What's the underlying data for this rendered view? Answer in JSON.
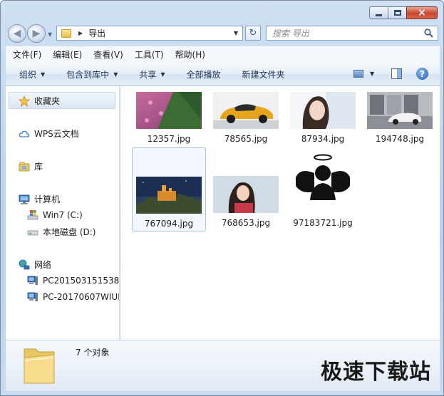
{
  "window": {
    "caption": {
      "minimize": "minimize",
      "maximize": "maximize",
      "close": "×"
    }
  },
  "navigation": {
    "address": {
      "path": "导出"
    },
    "search": {
      "placeholder": "搜索 导出"
    }
  },
  "menubar": {
    "items": [
      "文件(F)",
      "编辑(E)",
      "查看(V)",
      "工具(T)",
      "帮助(H)"
    ]
  },
  "commandbar": {
    "organize": "组织",
    "include_in_library": "包含到库中",
    "share": "共享",
    "play_all": "全部播放",
    "new_folder": "新建文件夹"
  },
  "navpane": {
    "favorites": "收藏夹",
    "wps_cloud": "WPS云文档",
    "libraries": "库",
    "computer": "计算机",
    "drive_c": "Win7 (C:)",
    "drive_d": "本地磁盘 (D:)",
    "network": "网络",
    "net_pc1": "PC201503151538",
    "net_pc2": "PC-20170607WIUN"
  },
  "files": [
    {
      "name": "12357.jpg",
      "selected": false
    },
    {
      "name": "78565.jpg",
      "selected": false
    },
    {
      "name": "87934.jpg",
      "selected": false
    },
    {
      "name": "194748.jpg",
      "selected": false
    },
    {
      "name": "767094.jpg",
      "selected": true
    },
    {
      "name": "768653.jpg",
      "selected": false
    },
    {
      "name": "97183721.jpg",
      "selected": false
    }
  ],
  "details": {
    "count": "7 个对象",
    "watermark": "极速下载站"
  },
  "colors": {
    "accent": "#2f5fa6",
    "selection_border": "#a9c3e6",
    "close_button": "#c8462f"
  }
}
